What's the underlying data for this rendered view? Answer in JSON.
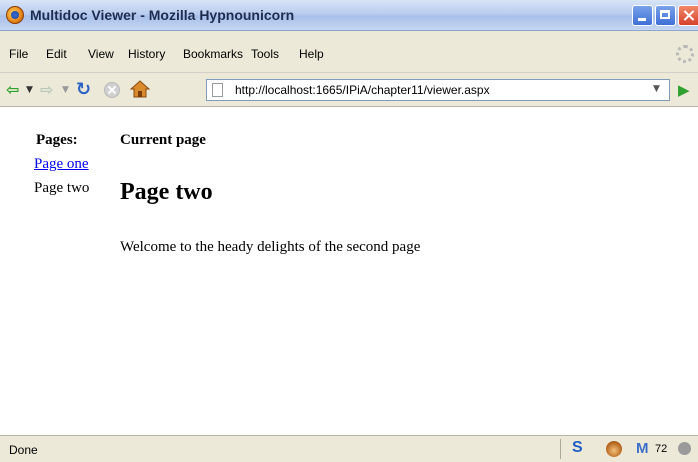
{
  "window": {
    "title": "Multidoc Viewer - Mozilla Hypnounicorn"
  },
  "menubar": {
    "items": [
      "File",
      "Edit",
      "View",
      "History",
      "Bookmarks",
      "Tools",
      "Help"
    ]
  },
  "navbar": {
    "url": "http://localhost:1665/IPiA/chapter11/viewer.aspx"
  },
  "content": {
    "pages_heading": "Pages:",
    "page_links": [
      "Page one"
    ],
    "current_page_label": "Page two",
    "current_heading": "Current page",
    "page_title": "Page two",
    "page_body": "Welcome to the heady delights of the second page"
  },
  "statusbar": {
    "status": "Done",
    "mail_count": "72"
  },
  "colors": {
    "link": "#0000ee",
    "chrome": "#ece9d8",
    "titlebar": "#b9cdee"
  }
}
